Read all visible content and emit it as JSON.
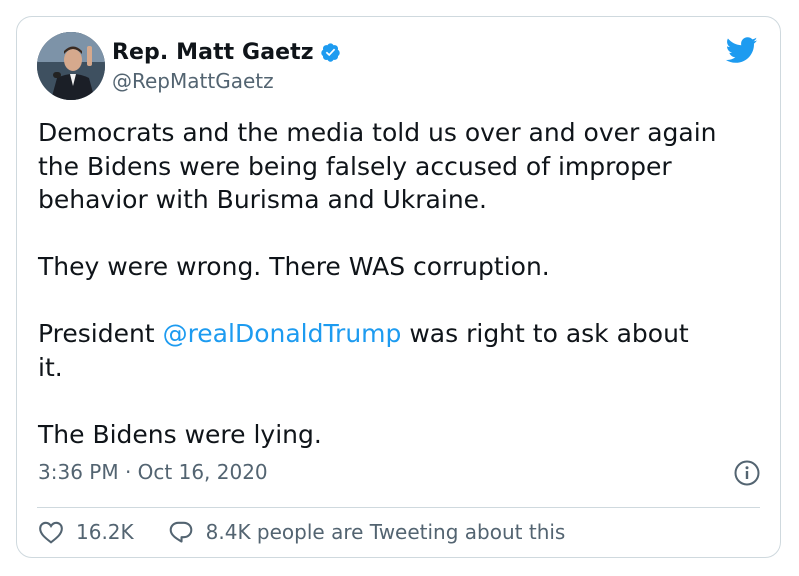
{
  "author": {
    "name": "Rep. Matt Gaetz",
    "handle": "@RepMattGaetz",
    "avatar_icon": "avatar-photo",
    "verified_icon": "verified-badge-icon"
  },
  "brand": {
    "icon": "twitter-bird-icon",
    "color": "#1d9bf0"
  },
  "tweet": {
    "para1_line1": "Democrats and the media told us over and over again",
    "para1_line2": "the Bidens were being falsely accused of improper",
    "para1_line3": "behavior with Burisma and Ukraine.",
    "para2": "They were wrong. There WAS corruption.",
    "para3_prefix": "President ",
    "para3_mention": "@realDonaldTrump",
    "para3_suffix": " was right to ask about",
    "para3_line2": "it.",
    "para4": "The Bidens were lying."
  },
  "meta": {
    "timestamp": "3:36 PM · Oct 16, 2020",
    "info_icon": "info-icon"
  },
  "actions": {
    "likes": "16.2K",
    "replies_text": "8.4K people are Tweeting about this"
  },
  "colors": {
    "text": "#0f1419",
    "secondary": "#536471",
    "link": "#1d9bf0",
    "border": "#cfd9de"
  }
}
